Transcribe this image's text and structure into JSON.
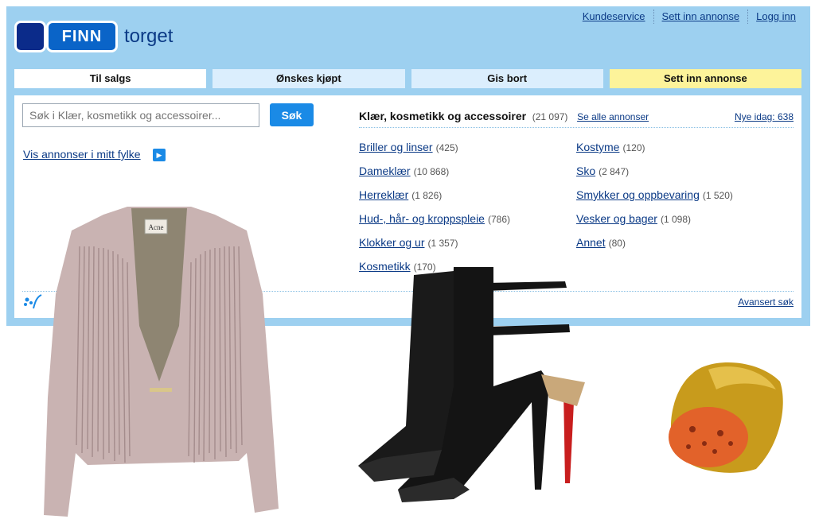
{
  "header": {
    "logo_text": "FINN",
    "section": "torget",
    "links": [
      "Kundeservice",
      "Sett inn annonse",
      "Logg inn"
    ]
  },
  "tabs": [
    {
      "label": "Til salgs",
      "state": "active"
    },
    {
      "label": "Ønskes kjøpt",
      "state": "normal"
    },
    {
      "label": "Gis bort",
      "state": "normal"
    },
    {
      "label": "Sett inn annonse",
      "state": "highlight"
    }
  ],
  "search": {
    "placeholder": "Søk i Klær, kosmetikk og accessoirer...",
    "button": "Søk"
  },
  "fylke_link": "Vis annonser i mitt fylke",
  "category": {
    "title": "Klær, kosmetikk og accessoirer",
    "count": "(21 097)",
    "see_all": "Se alle annonser",
    "new_today": "Nye idag: 638"
  },
  "subcategories_left": [
    {
      "label": "Briller og linser",
      "count": "(425)"
    },
    {
      "label": "Dameklær",
      "count": "(10 868)"
    },
    {
      "label": "Herreklær",
      "count": "(1 826)"
    },
    {
      "label": "Hud-, hår- og kroppspleie",
      "count": "(786)"
    },
    {
      "label": "Klokker og ur",
      "count": "(1 357)"
    },
    {
      "label": "Kosmetikk",
      "count": "(170)"
    }
  ],
  "subcategories_right": [
    {
      "label": "Kostyme",
      "count": "(120)"
    },
    {
      "label": "Sko",
      "count": "(2 847)"
    },
    {
      "label": "Smykker og oppbevaring",
      "count": "(1 520)"
    },
    {
      "label": "Vesker og bager",
      "count": "(1 098)"
    },
    {
      "label": "Annet",
      "count": "(80)"
    }
  ],
  "advanced_search": "Avansert søk",
  "jacket_label": "Acne",
  "colors": {
    "frame": "#9dd0f0",
    "link": "#0b3a86",
    "button": "#1a8ae6",
    "post_tab": "#fdf39a"
  }
}
